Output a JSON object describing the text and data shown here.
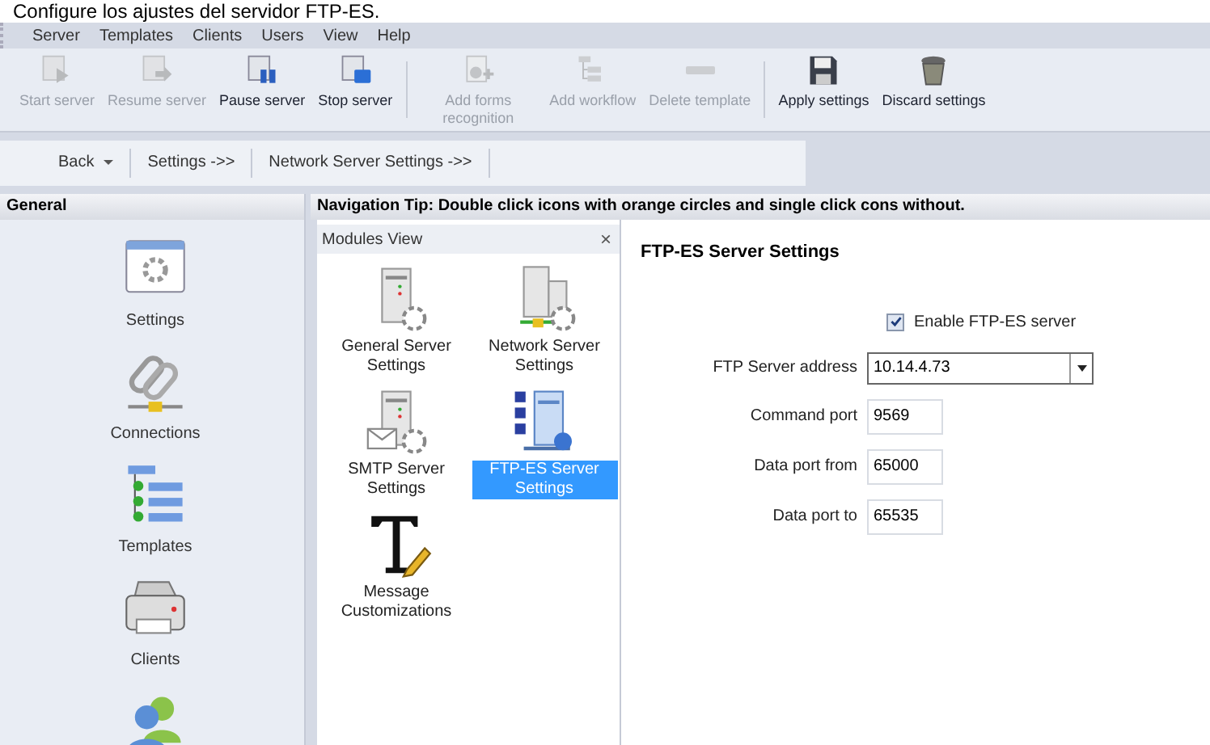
{
  "heading": "Configure los ajustes del servidor FTP-ES.",
  "menu": [
    "Server",
    "Templates",
    "Clients",
    "Users",
    "View",
    "Help"
  ],
  "toolbar": {
    "groups": [
      [
        {
          "label": "Start server",
          "disabled": true
        },
        {
          "label": "Resume server",
          "disabled": true
        },
        {
          "label": "Pause server",
          "disabled": false
        },
        {
          "label": "Stop server",
          "disabled": false
        }
      ],
      [
        {
          "label": "Add forms recognition",
          "disabled": true
        },
        {
          "label": "Add workflow",
          "disabled": true
        },
        {
          "label": "Delete template",
          "disabled": true
        }
      ],
      [
        {
          "label": "Apply settings",
          "disabled": false
        },
        {
          "label": "Discard settings",
          "disabled": false
        }
      ]
    ]
  },
  "breadcrumbs": [
    {
      "label": "Back",
      "kind": "dropdown"
    },
    {
      "label": "Settings ->>",
      "kind": "link"
    },
    {
      "label": "Network Server Settings ->>",
      "kind": "link"
    }
  ],
  "sidebar": {
    "title": "General",
    "items": [
      {
        "label": "Settings"
      },
      {
        "label": "Connections"
      },
      {
        "label": "Templates"
      },
      {
        "label": "Clients"
      }
    ],
    "more_below": true
  },
  "navigation_tip": "Navigation Tip: Double click icons with orange circles and single click cons without.",
  "modules": {
    "title": "Modules View",
    "close": "×",
    "items": [
      {
        "label": "General Server Settings",
        "selected": false
      },
      {
        "label": "Network Server Settings",
        "selected": false
      },
      {
        "label": "SMTP Server Settings",
        "selected": false
      },
      {
        "label": "FTP-ES Server Settings",
        "selected": true
      },
      {
        "label": "Message Customizations",
        "selected": false
      }
    ]
  },
  "settings": {
    "title": "FTP-ES Server Settings",
    "enable": {
      "label": "Enable FTP-ES server",
      "checked": true
    },
    "fields": [
      {
        "label": "FTP Server address",
        "value": "10.14.4.73",
        "kind": "combo"
      },
      {
        "label": "Command port",
        "value": "9569",
        "kind": "text"
      },
      {
        "label": "Data port from",
        "value": "65000",
        "kind": "text"
      },
      {
        "label": "Data port to",
        "value": "65535",
        "kind": "text"
      }
    ]
  }
}
